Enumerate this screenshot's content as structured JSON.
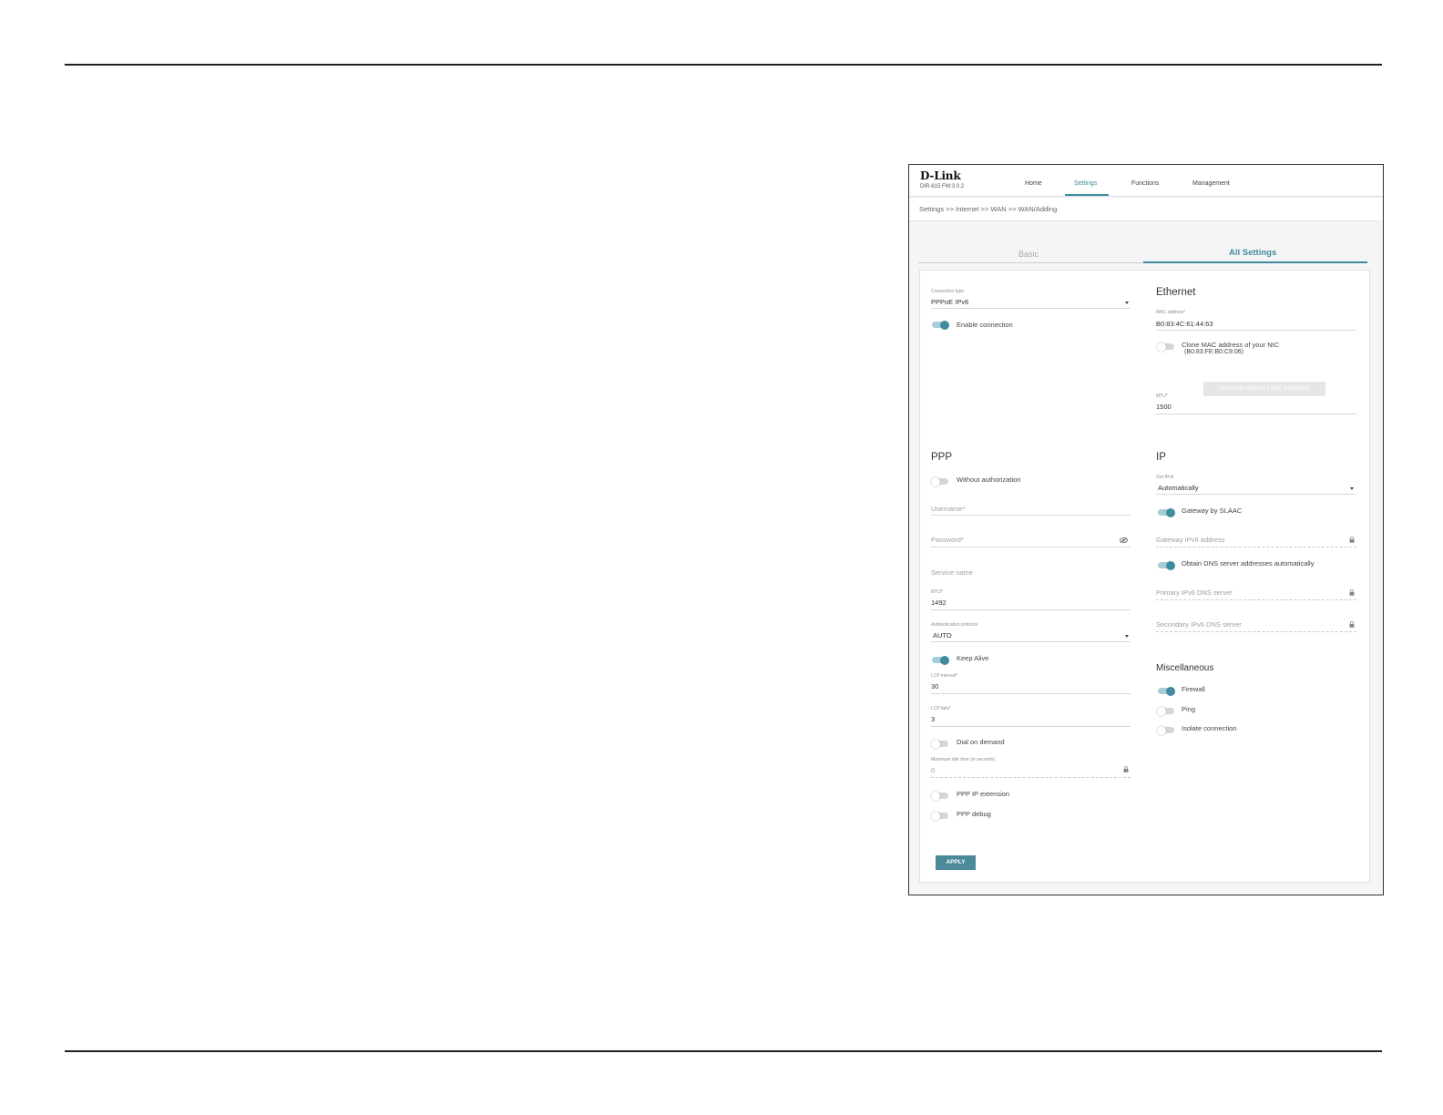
{
  "header": {
    "logo": "D-Link",
    "model": "DIR-615 FW:3.0.2",
    "nav": [
      "Home",
      "Settings",
      "Functions",
      "Management"
    ],
    "active_nav": "Settings"
  },
  "breadcrumb": "Settings >> Internet >> WAN >> WAN/Adding",
  "tabs": {
    "basic": "Basic",
    "all": "All Settings"
  },
  "general": {
    "connection_type_label": "Connection type",
    "connection_type_value": "PPPoE IPv6",
    "enable_connection": {
      "label": "Enable connection",
      "on": true
    }
  },
  "ethernet": {
    "heading": "Ethernet",
    "mac_label": "MAC address*",
    "mac_value": "B0:83:4C:61:44:63",
    "clone_label": "Clone MAC address of your NIC",
    "clone_mac": "(B0:83:FE:B0:C9:06)",
    "clone_on": false,
    "restore_button": "RESTORE DEFAULT MAC ADDRESS",
    "mtu_label": "MTU*",
    "mtu_value": "1500"
  },
  "ppp": {
    "heading": "PPP",
    "without_auth": {
      "label": "Without authorization",
      "on": false
    },
    "username_placeholder": "Username*",
    "password_placeholder": "Password*",
    "service_name_placeholder": "Service name",
    "mtu_label": "MTU*",
    "mtu_value": "1492",
    "auth_protocol_label": "Authentication protocol",
    "auth_protocol_value": "AUTO",
    "keep_alive": {
      "label": "Keep Alive",
      "on": true
    },
    "lcp_interval_label": "LCP interval*",
    "lcp_interval_value": "30",
    "lcp_fails_label": "LCP fails*",
    "lcp_fails_value": "3",
    "dial_on_demand": {
      "label": "Dial on demand",
      "on": false
    },
    "max_idle_label": "Maximum idle time (in seconds)",
    "max_idle_value": "0",
    "ppp_ip_extension": {
      "label": "PPP IP extension",
      "on": false
    },
    "ppp_debug": {
      "label": "PPP debug",
      "on": false
    }
  },
  "ip": {
    "heading": "IP",
    "get_ipv6_label": "Get IPv6",
    "get_ipv6_value": "Automatically",
    "gateway_slaac": {
      "label": "Gateway by SLAAC",
      "on": true
    },
    "gateway_ipv6_placeholder": "Gateway IPv6 address",
    "obtain_dns": {
      "label": "Obtain DNS server addresses automatically",
      "on": true
    },
    "primary_dns_placeholder": "Primary IPv6 DNS server",
    "secondary_dns_placeholder": "Secondary IPv6 DNS server"
  },
  "misc": {
    "heading": "Miscellaneous",
    "firewall": {
      "label": "Firewall",
      "on": true
    },
    "ping": {
      "label": "Ping",
      "on": false
    },
    "isolate": {
      "label": "Isolate connection",
      "on": false
    }
  },
  "apply_button": "APPLY",
  "colors": {
    "accent": "#3f8c9e",
    "apply": "#4a8a9b",
    "rule": "#231f20"
  }
}
